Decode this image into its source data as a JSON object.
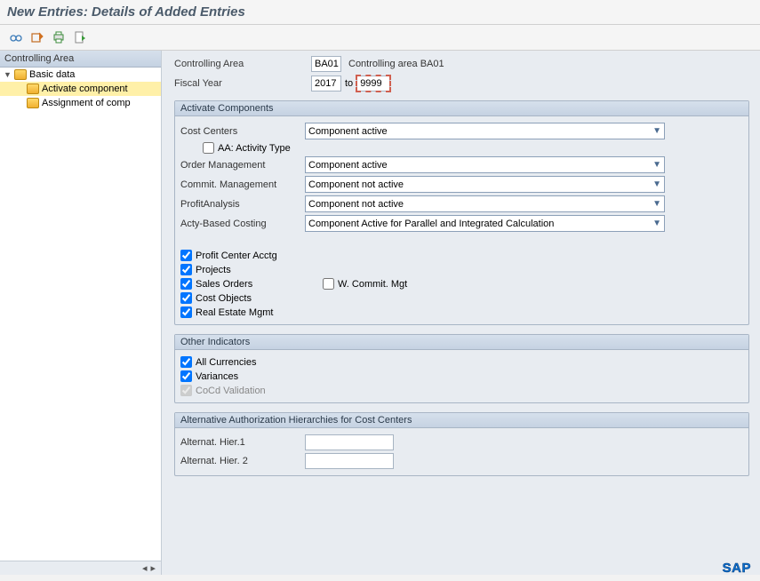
{
  "title": "New Entries: Details of Added Entries",
  "sidebar": {
    "header": "Controlling Area",
    "root": "Basic data",
    "items": [
      "Activate component",
      "Assignment of comp"
    ]
  },
  "header": {
    "controlling_area_label": "Controlling Area",
    "controlling_area_value": "BA01",
    "controlling_area_desc": "Controlling area BA01",
    "fiscal_year_label": "Fiscal Year",
    "fiscal_year_from": "2017",
    "fiscal_year_to_word": "to",
    "fiscal_year_to": "9999"
  },
  "activate_components": {
    "title": "Activate Components",
    "cost_centers_label": "Cost Centers",
    "cost_centers_value": "Component active",
    "aa_activity_label": "AA: Activity Type",
    "order_mgmt_label": "Order Management",
    "order_mgmt_value": "Component active",
    "commit_mgmt_label": "Commit. Management",
    "commit_mgmt_value": "Component not active",
    "profit_analysis_label": "ProfitAnalysis",
    "profit_analysis_value": "Component not active",
    "abc_label": "Acty-Based Costing",
    "abc_value": "Component Active for Parallel and Integrated Calculation",
    "cb_profit_center": "Profit Center Acctg",
    "cb_projects": "Projects",
    "cb_sales_orders": "Sales Orders",
    "cb_w_commit": "W. Commit. Mgt",
    "cb_cost_objects": "Cost Objects",
    "cb_real_estate": "Real Estate Mgmt"
  },
  "other_indicators": {
    "title": "Other Indicators",
    "cb_all_currencies": "All Currencies",
    "cb_variances": "Variances",
    "cb_cocd": "CoCd Validation"
  },
  "alt_auth": {
    "title": "Alternative Authorization Hierarchies for Cost Centers",
    "hier1_label": "Alternat. Hier.1",
    "hier2_label": "Alternat. Hier. 2"
  },
  "logo": "SAP"
}
